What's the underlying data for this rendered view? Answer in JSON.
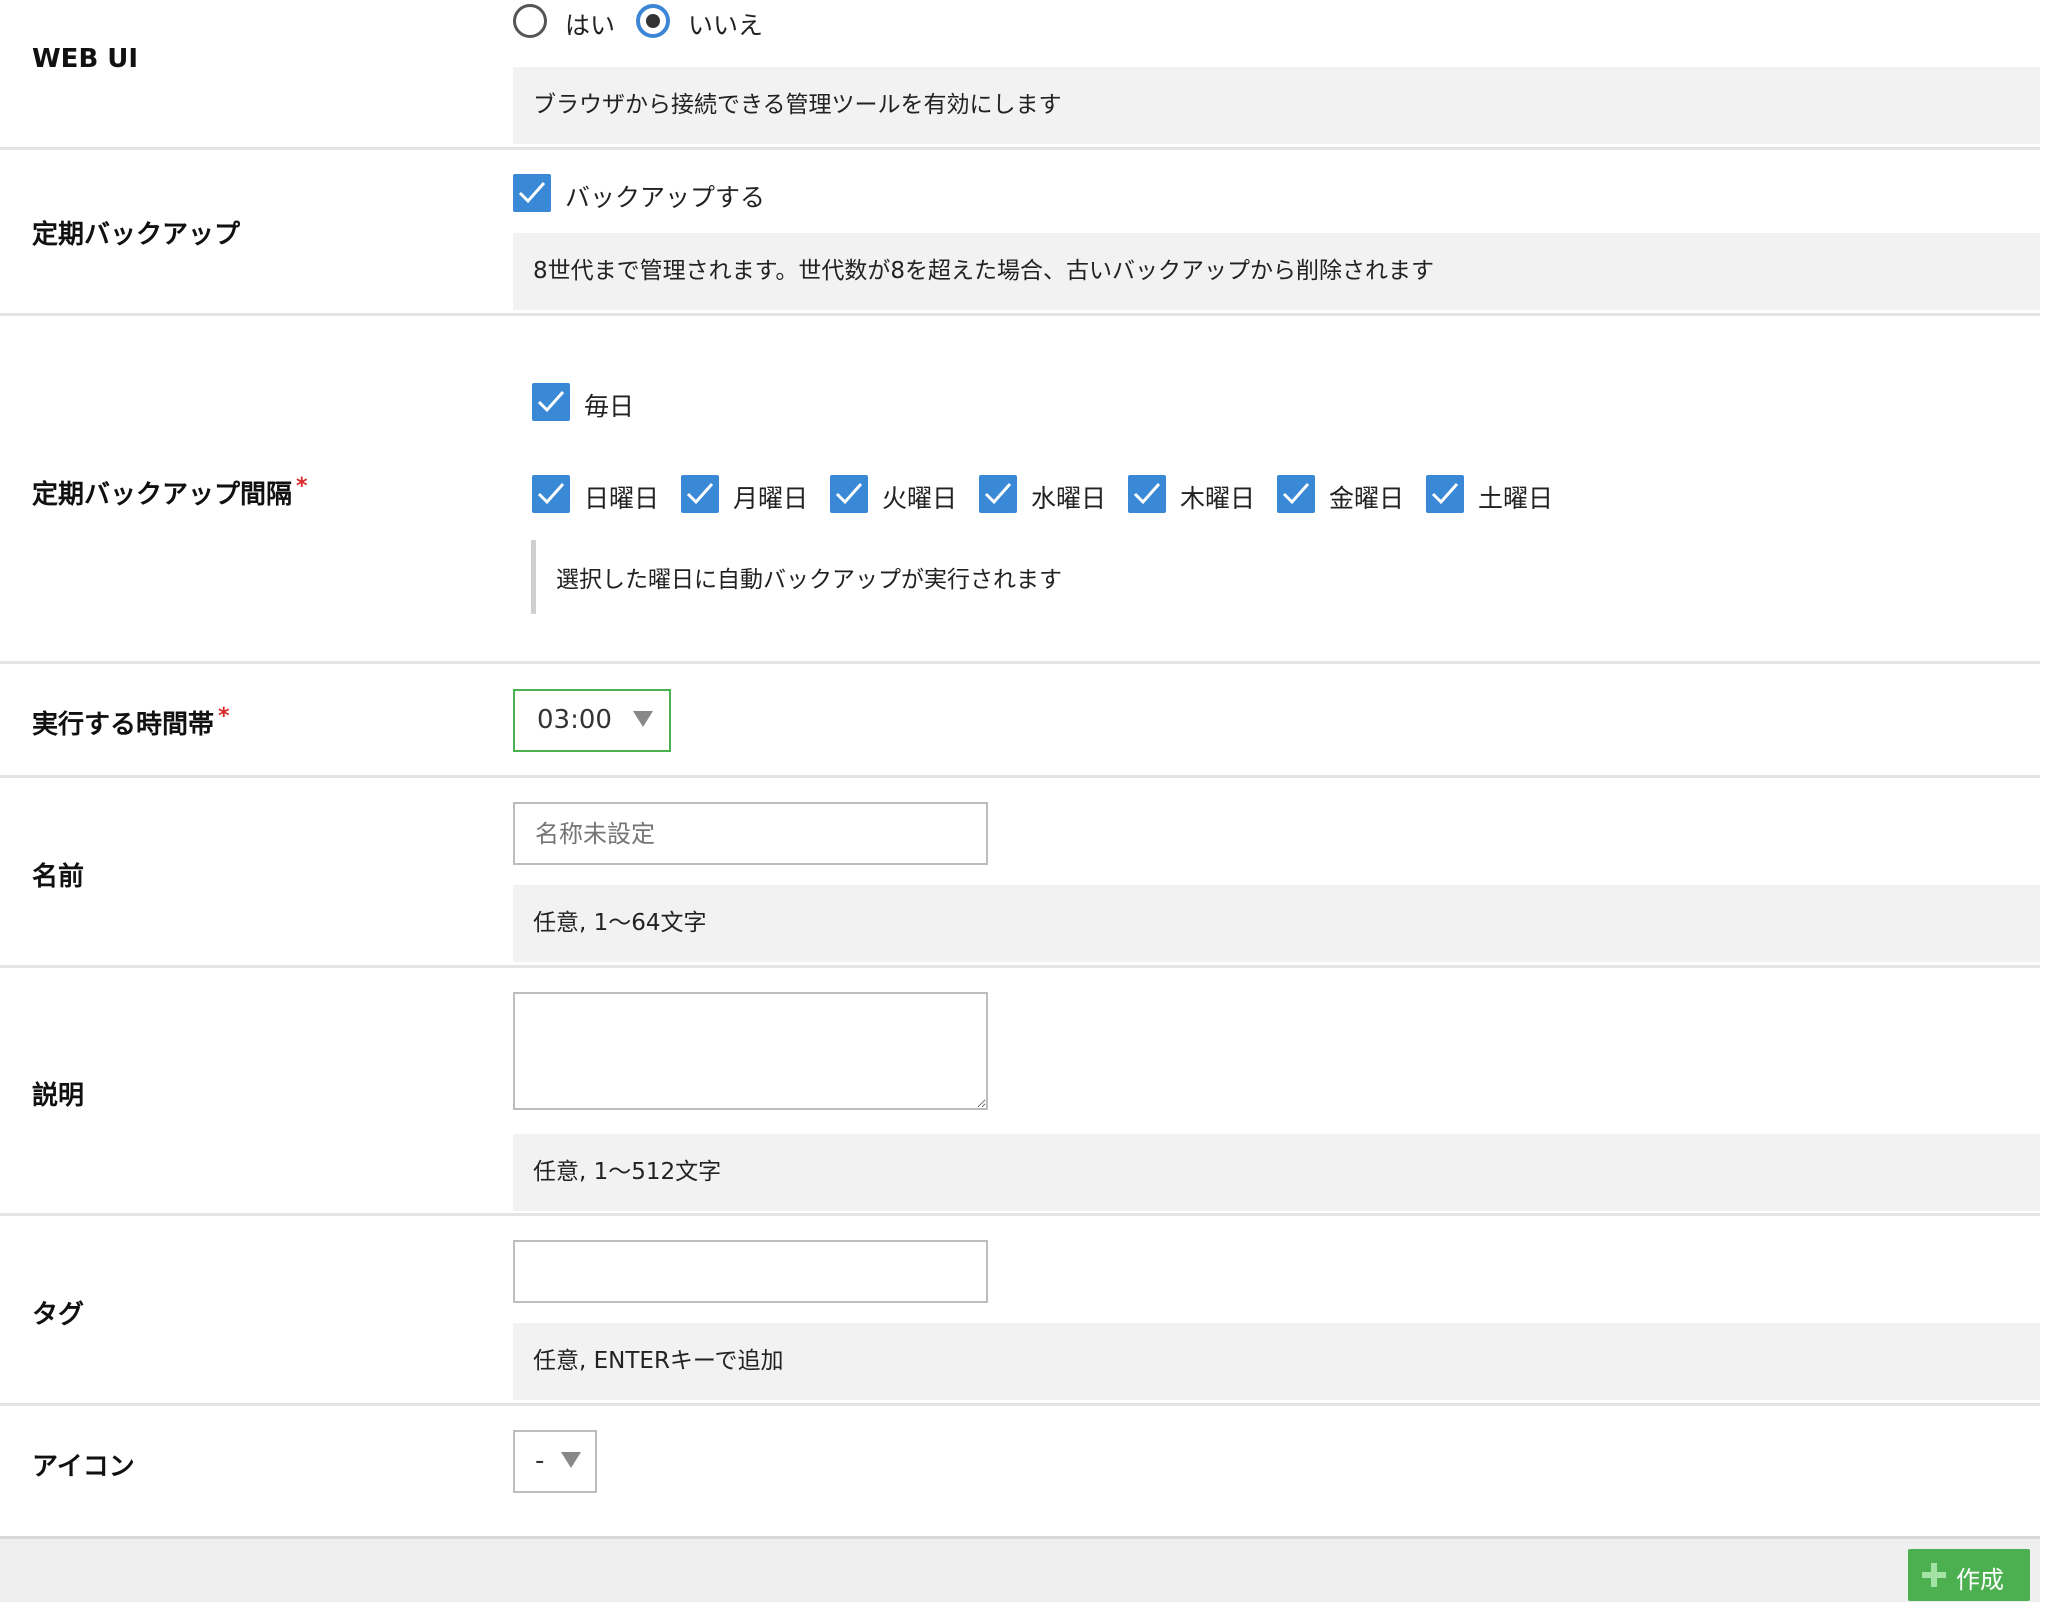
{
  "webui": {
    "label": "WEB UI",
    "options": [
      "はい",
      "いいえ"
    ],
    "selected": "いいえ",
    "hint": "ブラウザから接続できる管理ツールを有効にします"
  },
  "backup": {
    "label": "定期バックアップ",
    "checkbox_label": "バックアップする",
    "checked": true,
    "hint": "8世代まで管理されます。世代数が8を超えた場合、古いバックアップから削除されます"
  },
  "interval": {
    "label": "定期バックアップ間隔",
    "required_mark": "*",
    "daily_label": "毎日",
    "days": [
      "日曜日",
      "月曜日",
      "火曜日",
      "水曜日",
      "木曜日",
      "金曜日",
      "土曜日"
    ],
    "hint": "選択した曜日に自動バックアップが実行されます"
  },
  "time": {
    "label": "実行する時間帯",
    "required_mark": "*",
    "value": "03:00"
  },
  "name": {
    "label": "名前",
    "placeholder": "名称未設定",
    "hint": "任意, 1〜64文字"
  },
  "description": {
    "label": "説明",
    "hint": "任意, 1〜512文字"
  },
  "tags": {
    "label": "タグ",
    "hint": "任意, ENTERキーで追加"
  },
  "icon": {
    "label": "アイコン",
    "value": "-"
  },
  "footer": {
    "create_label": "作成"
  },
  "colors": {
    "checkbox": "#3a89d6",
    "radio_accent": "#3d86d5",
    "create_button": "#4caf50",
    "required": "#d9282a",
    "focused_select_border": "#4caf50"
  }
}
